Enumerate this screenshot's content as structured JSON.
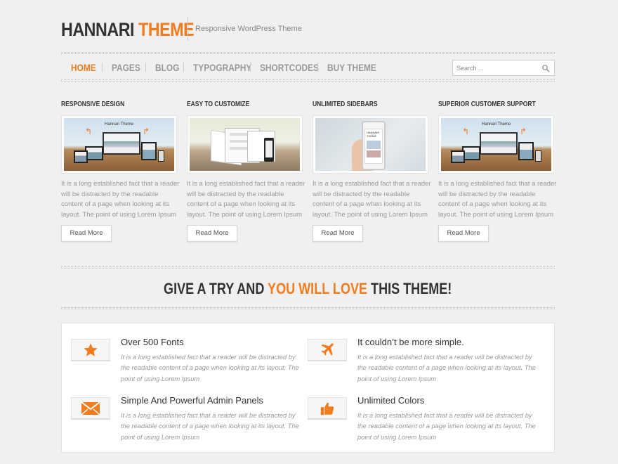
{
  "header": {
    "logo_part1": "HANNARI",
    "logo_part2": "THEME",
    "tagline": "Responsive WordPress Theme"
  },
  "nav": {
    "items": [
      {
        "label": "HOME",
        "active": true
      },
      {
        "label": "PAGES",
        "active": false
      },
      {
        "label": "BLOG",
        "active": false
      },
      {
        "label": "TYPOGRAPHY",
        "active": false
      },
      {
        "label": "SHORTCODES",
        "active": false
      },
      {
        "label": "BUY THEME",
        "active": false
      }
    ]
  },
  "search": {
    "placeholder": "Search ...",
    "icon": "search-icon"
  },
  "cards": [
    {
      "title": "RESPONSIVE DESIGN",
      "text": "It is a long established fact that a reader will be distracted by the readable content of a page when looking at its layout. The point of using Lorem Ipsum",
      "button": "Read More",
      "image_caption": "Hannari Theme"
    },
    {
      "title": "EASY TO CUSTOMIZE",
      "text": "It is a long established fact that a reader will be distracted by the readable content of a page when looking at its layout. The point of using Lorem Ipsum",
      "button": "Read More"
    },
    {
      "title": "UNLIMITED SIDEBARS",
      "text": "It is a long established fact that a reader will be distracted by the readable content of a page when looking at its layout. The point of using Lorem Ipsum",
      "button": "Read More",
      "image_caption": "HANNARI THEME"
    },
    {
      "title": "SUPERIOR CUSTOMER SUPPORT",
      "text": "It is a long established fact that a reader will be distracted by the readable content of a page when looking at its layout. The point of using Lorem Ipsum",
      "button": "Read More",
      "image_caption": "Hannari Theme"
    }
  ],
  "cta": {
    "part1": "GIVE A TRY AND ",
    "part2": "YOU WILL LOVE",
    "part3": " THIS THEME!"
  },
  "features": [
    {
      "icon": "star-icon",
      "title": "Over 500 Fonts",
      "text": "It is a long established fact that a reader will be distracted by the readable content of a page when looking at its layout. The point of using Lorem Ipsum"
    },
    {
      "icon": "airplane-icon",
      "title": "It couldn’t be more simple.",
      "text": "It is a long established fact that a reader will be distracted by the readable content of a page when looking at its layout. The point of using Lorem Ipsum"
    },
    {
      "icon": "envelope-icon",
      "title": "Simple And Powerful Admin Panels",
      "text": "It is a long established fact that a reader will be distracted by the readable content of a page when looking at its layout. The point of using Lorem Ipsum"
    },
    {
      "icon": "thumbs-up-icon",
      "title": "Unlimited Colors",
      "text": "It is a long established fact that a reader will be distracted by the readable content of a page when looking at its layout. The point of using Lorem Ipsum"
    }
  ],
  "colors": {
    "accent": "#f07c1e",
    "background": "#f0f0f0",
    "text_dark": "#333333",
    "text_muted": "#999999"
  }
}
